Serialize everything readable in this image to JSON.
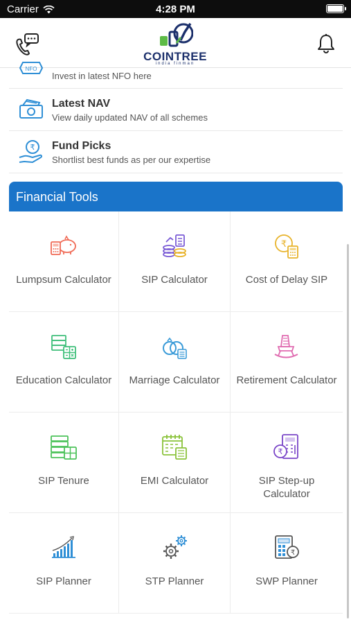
{
  "status_bar": {
    "carrier": "Carrier",
    "time": "4:28 PM"
  },
  "app_bar": {
    "logo_text": "COINTREE",
    "logo_subtext": "india finman",
    "left_icon": "phone-chat-icon",
    "right_icon": "bell-icon"
  },
  "services": [
    {
      "title": "",
      "desc": "Invest in latest NFO here",
      "icon": "nfo-icon"
    },
    {
      "title": "Latest NAV",
      "desc": "View daily updated NAV of all schemes",
      "icon": "money-icon"
    },
    {
      "title": "Fund Picks",
      "desc": "Shortlist best funds as per our expertise",
      "icon": "rupee-hand-icon"
    }
  ],
  "financial_tools": {
    "header": "Financial Tools",
    "items": [
      {
        "label": "Lumpsum Calculator",
        "icon": "piggy-bank-calculator-icon",
        "color": "#f06a55"
      },
      {
        "label": "SIP Calculator",
        "icon": "coins-stack-icon",
        "color": "#7b5cd6"
      },
      {
        "label": "Cost of Delay SIP",
        "icon": "rupee-coin-calculator-icon",
        "color": "#e8b32a"
      },
      {
        "label": "Education Calculator",
        "icon": "education-calculator-icon",
        "color": "#3fbf7a"
      },
      {
        "label": "Marriage Calculator",
        "icon": "rings-calculator-icon",
        "color": "#3a9bd8"
      },
      {
        "label": "Retirement Calculator",
        "icon": "rocking-chair-icon",
        "color": "#e06bb0"
      },
      {
        "label": "SIP Tenure",
        "icon": "sip-tenure-icon",
        "color": "#4cc25a"
      },
      {
        "label": "EMI Calculator",
        "icon": "calendar-calculator-icon",
        "color": "#8ac23a"
      },
      {
        "label": "SIP Step-up Calculator",
        "icon": "step-up-calculator-icon",
        "color": "#7a45c8"
      },
      {
        "label": "SIP Planner",
        "icon": "bar-growth-icon",
        "color": "#2f8fd6"
      },
      {
        "label": "STP Planner",
        "icon": "gears-icon",
        "color": "#555555"
      },
      {
        "label": "SWP Planner",
        "icon": "swp-calculator-icon",
        "color": "#2f8fd6"
      }
    ]
  },
  "colors": {
    "primary": "#1a74c9",
    "logo_navy": "#1b2f6b",
    "logo_green": "#5dbb46"
  }
}
